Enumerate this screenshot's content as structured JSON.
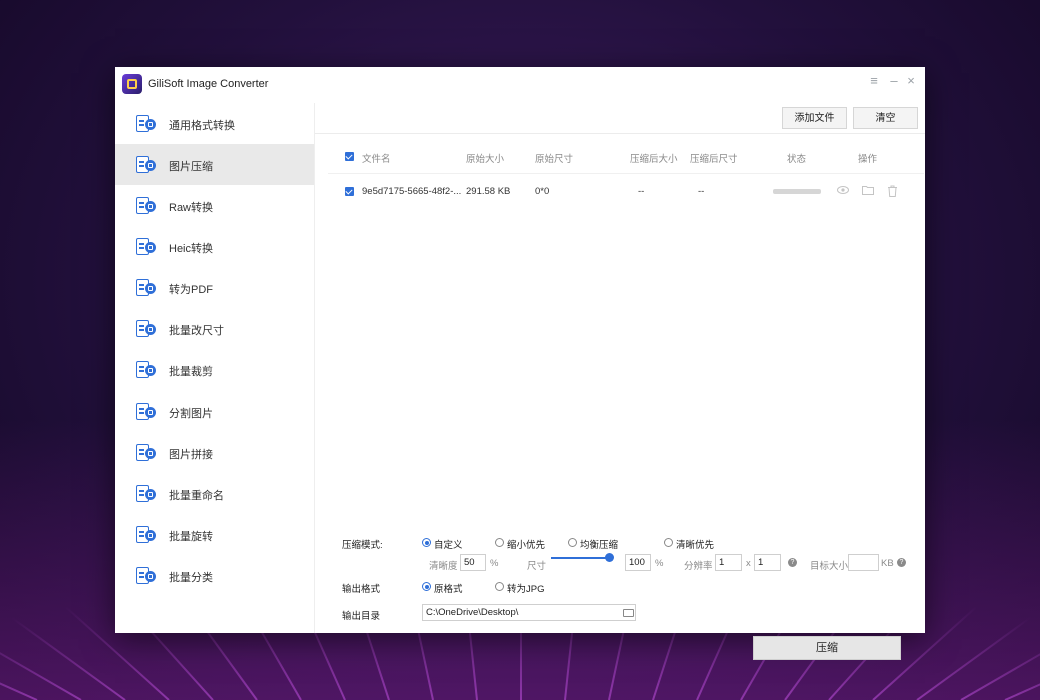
{
  "window": {
    "title": "GiliSoft Image Converter"
  },
  "sidebar": {
    "items": [
      {
        "label": "通用格式转换",
        "active": false
      },
      {
        "label": "图片压缩",
        "active": true
      },
      {
        "label": "Raw转换",
        "active": false
      },
      {
        "label": "Heic转换",
        "active": false
      },
      {
        "label": "转为PDF",
        "active": false
      },
      {
        "label": "批量改尺寸",
        "active": false
      },
      {
        "label": "批量裁剪",
        "active": false
      },
      {
        "label": "分割图片",
        "active": false
      },
      {
        "label": "图片拼接",
        "active": false
      },
      {
        "label": "批量重命名",
        "active": false
      },
      {
        "label": "批量旋转",
        "active": false
      },
      {
        "label": "批量分类",
        "active": false
      }
    ]
  },
  "toolbar": {
    "add_file_label": "添加文件",
    "clear_label": "清空"
  },
  "table": {
    "headers": {
      "filename": "文件名",
      "orig_size": "原始大小",
      "orig_dim": "原始尺寸",
      "comp_size": "压缩后大小",
      "comp_dim": "压缩后尺寸",
      "status": "状态",
      "actions": "操作"
    },
    "rows": [
      {
        "checked": true,
        "filename": "9e5d7175-5665-48f2-...",
        "orig_size": "291.58 KB",
        "orig_dim": "0*0",
        "comp_size": "--",
        "comp_dim": "--"
      }
    ]
  },
  "settings": {
    "mode_label": "压缩模式:",
    "modes": [
      {
        "label": "自定义",
        "selected": true
      },
      {
        "label": "缩小优先",
        "selected": false
      },
      {
        "label": "均衡压缩",
        "selected": false
      },
      {
        "label": "清晰优先",
        "selected": false
      }
    ],
    "clarity_label": "清晰度",
    "clarity_value": "50",
    "clarity_unit": "%",
    "size_label": "尺寸",
    "size_value": "100",
    "size_unit": "%",
    "resolution_label": "分辨率",
    "res_x": "1",
    "res_sep": "x",
    "res_y": "1",
    "target_label": "目标大小",
    "target_value": "",
    "target_unit": "KB",
    "format_label": "输出格式",
    "formats": [
      {
        "label": "原格式",
        "selected": true
      },
      {
        "label": "转为JPG",
        "selected": false
      }
    ],
    "dir_label": "输出目录",
    "dir_value": "C:\\OneDrive\\Desktop\\"
  },
  "compress_button_label": "压缩",
  "icons": {
    "menu": "≡",
    "minimize": "–",
    "close": "×",
    "preview": "eye-icon",
    "open_folder": "folder-icon",
    "delete": "trash-icon",
    "help": "?"
  }
}
